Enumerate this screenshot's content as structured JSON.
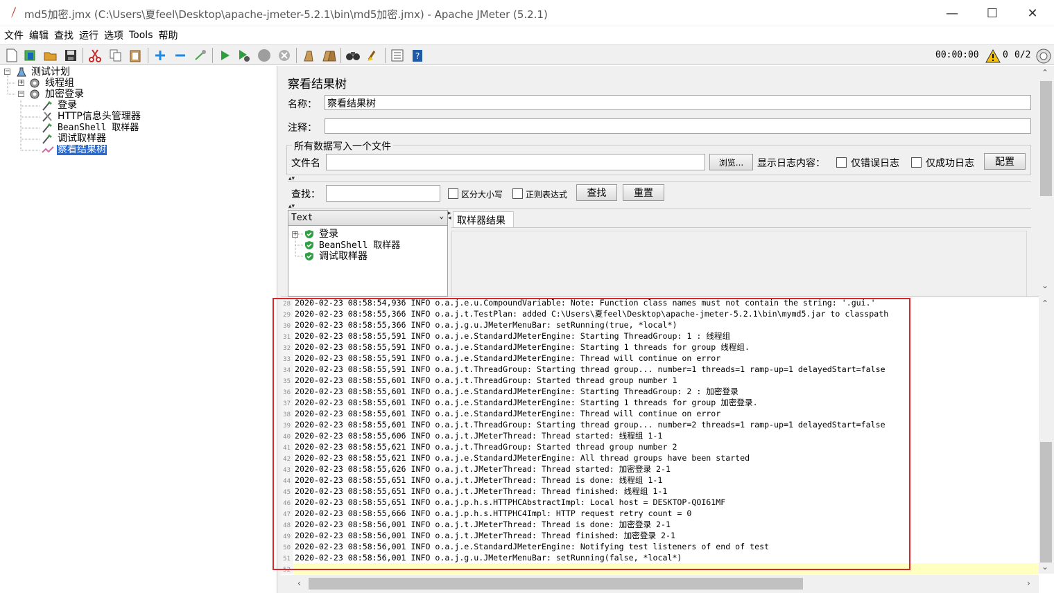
{
  "window": {
    "title": "md5加密.jmx (C:\\Users\\夏feel\\Desktop\\apache-jmeter-5.2.1\\bin\\md5加密.jmx) - Apache JMeter (5.2.1)",
    "minimize": "—",
    "maximize": "☐",
    "close": "✕"
  },
  "menu": [
    "文件",
    "编辑",
    "查找",
    "运行",
    "选项",
    "Tools",
    "帮助"
  ],
  "toolbar_status": {
    "timer": "00:00:00",
    "warnings": "0",
    "threads": "0/2"
  },
  "tree": {
    "root": "测试计划",
    "nodes": [
      "线程组",
      "加密登录",
      "登录",
      "HTTP信息头管理器",
      "BeanShell 取样器",
      "调试取样器",
      "察看结果树"
    ]
  },
  "panel": {
    "title": "察看结果树",
    "name_label": "名称：",
    "name_value": "察看结果树",
    "comment_label": "注释：",
    "comment_value": "",
    "file_group": "所有数据写入一个文件",
    "filename_label": "文件名",
    "browse_button": "浏览...",
    "log_content_label": "显示日志内容：",
    "errors_only": "仅错误日志",
    "success_only": "仅成功日志",
    "config_button": "配置",
    "search_label": "查找：",
    "case_sensitive": "区分大小写",
    "regex": "正则表达式",
    "find_button": "查找",
    "reset_button": "重置",
    "renderer": "Text",
    "result_tab": "取样器结果",
    "results": [
      "登录",
      "BeanShell 取样器",
      "调试取样器"
    ]
  },
  "log": [
    {
      "n": "28",
      "t": "2020-02-23 08:58:54,936 INFO o.a.j.e.u.CompoundVariable: Note: Function class names must not contain the string: '.gui.'"
    },
    {
      "n": "29",
      "t": "2020-02-23 08:58:55,366 INFO o.a.j.t.TestPlan: added C:\\Users\\夏feel\\Desktop\\apache-jmeter-5.2.1\\bin\\mymd5.jar to classpath"
    },
    {
      "n": "30",
      "t": "2020-02-23 08:58:55,366 INFO o.a.j.g.u.JMeterMenuBar: setRunning(true, *local*)"
    },
    {
      "n": "31",
      "t": "2020-02-23 08:58:55,591 INFO o.a.j.e.StandardJMeterEngine: Starting ThreadGroup: 1 : 线程组"
    },
    {
      "n": "32",
      "t": "2020-02-23 08:58:55,591 INFO o.a.j.e.StandardJMeterEngine: Starting 1 threads for group 线程组."
    },
    {
      "n": "33",
      "t": "2020-02-23 08:58:55,591 INFO o.a.j.e.StandardJMeterEngine: Thread will continue on error"
    },
    {
      "n": "34",
      "t": "2020-02-23 08:58:55,591 INFO o.a.j.t.ThreadGroup: Starting thread group... number=1 threads=1 ramp-up=1 delayedStart=false"
    },
    {
      "n": "35",
      "t": "2020-02-23 08:58:55,601 INFO o.a.j.t.ThreadGroup: Started thread group number 1"
    },
    {
      "n": "36",
      "t": "2020-02-23 08:58:55,601 INFO o.a.j.e.StandardJMeterEngine: Starting ThreadGroup: 2 : 加密登录"
    },
    {
      "n": "37",
      "t": "2020-02-23 08:58:55,601 INFO o.a.j.e.StandardJMeterEngine: Starting 1 threads for group 加密登录."
    },
    {
      "n": "38",
      "t": "2020-02-23 08:58:55,601 INFO o.a.j.e.StandardJMeterEngine: Thread will continue on error"
    },
    {
      "n": "39",
      "t": "2020-02-23 08:58:55,601 INFO o.a.j.t.ThreadGroup: Starting thread group... number=2 threads=1 ramp-up=1 delayedStart=false"
    },
    {
      "n": "40",
      "t": "2020-02-23 08:58:55,606 INFO o.a.j.t.JMeterThread: Thread started: 线程组 1-1"
    },
    {
      "n": "41",
      "t": "2020-02-23 08:58:55,621 INFO o.a.j.t.ThreadGroup: Started thread group number 2"
    },
    {
      "n": "42",
      "t": "2020-02-23 08:58:55,621 INFO o.a.j.e.StandardJMeterEngine: All thread groups have been started"
    },
    {
      "n": "43",
      "t": "2020-02-23 08:58:55,626 INFO o.a.j.t.JMeterThread: Thread started: 加密登录 2-1"
    },
    {
      "n": "44",
      "t": "2020-02-23 08:58:55,651 INFO o.a.j.t.JMeterThread: Thread is done: 线程组 1-1"
    },
    {
      "n": "45",
      "t": "2020-02-23 08:58:55,651 INFO o.a.j.t.JMeterThread: Thread finished: 线程组 1-1"
    },
    {
      "n": "46",
      "t": "2020-02-23 08:58:55,651 INFO o.a.j.p.h.s.HTTPHCAbstractImpl: Local host = DESKTOP-QOI61MF"
    },
    {
      "n": "47",
      "t": "2020-02-23 08:58:55,666 INFO o.a.j.p.h.s.HTTPHC4Impl: HTTP request retry count = 0"
    },
    {
      "n": "48",
      "t": "2020-02-23 08:58:56,001 INFO o.a.j.t.JMeterThread: Thread is done: 加密登录 2-1"
    },
    {
      "n": "49",
      "t": "2020-02-23 08:58:56,001 INFO o.a.j.t.JMeterThread: Thread finished: 加密登录 2-1"
    },
    {
      "n": "50",
      "t": "2020-02-23 08:58:56,001 INFO o.a.j.e.StandardJMeterEngine: Notifying test listeners of end of test"
    },
    {
      "n": "51",
      "t": "2020-02-23 08:58:56,001 INFO o.a.j.g.u.JMeterMenuBar: setRunning(false, *local*)"
    },
    {
      "n": "52",
      "t": ""
    }
  ],
  "colors": {
    "selection": "#2a6acf",
    "highlight_box": "#d9272e",
    "current_line": "#ffffc0",
    "success": "#2ea043"
  }
}
